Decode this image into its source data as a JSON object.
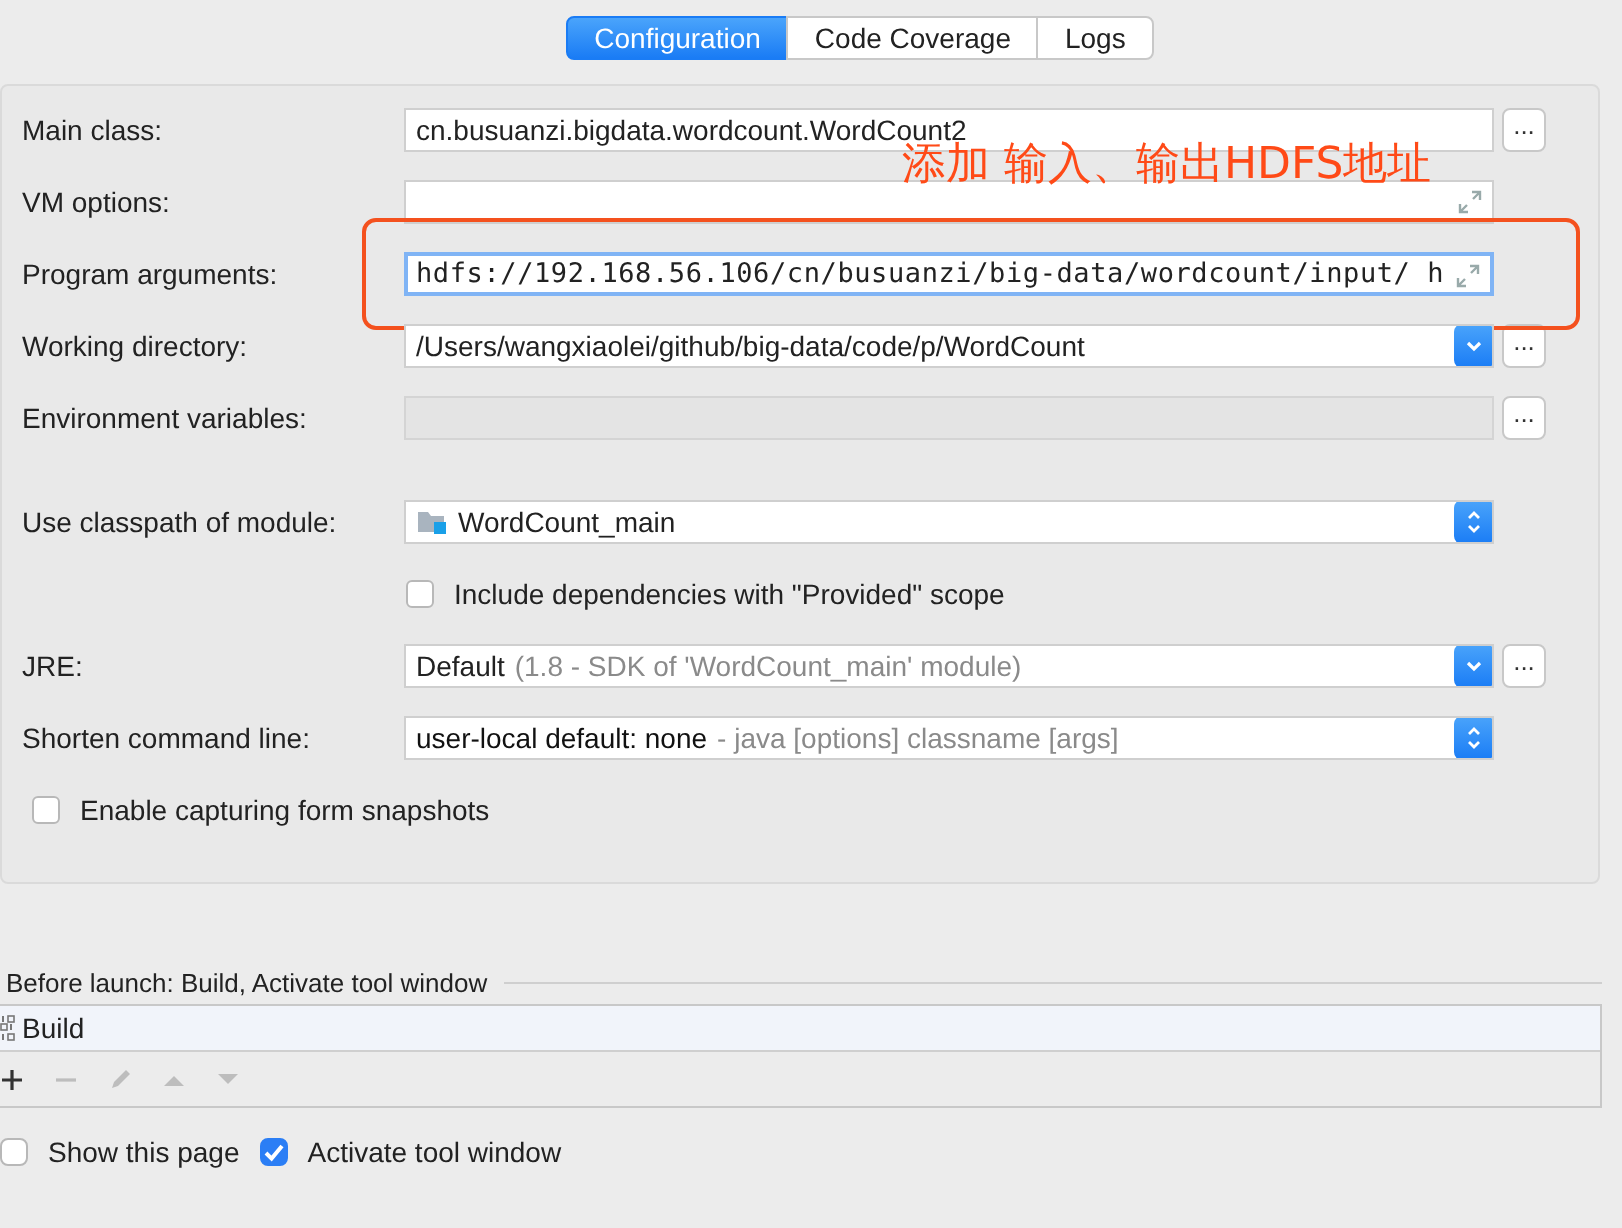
{
  "tabs": [
    {
      "label": "Configuration",
      "selected": true
    },
    {
      "label": "Code Coverage",
      "selected": false
    },
    {
      "label": "Logs",
      "selected": false
    }
  ],
  "form": {
    "annotation": {
      "text": "添加 输入、输出HDFS地址"
    },
    "rows": [
      {
        "kind": "text",
        "label": "Main class:",
        "value": "cn.busuanzi.bigdata.wordcount.WordCount2",
        "browse": "..."
      },
      {
        "kind": "expand",
        "label": "VM options:"
      },
      {
        "kind": "expand",
        "label": "Program arguments:",
        "value": "hdfs://192.168.56.106/cn/busuanzi/big-data/wordcount/input/ h",
        "focused": true,
        "annotated": true
      },
      {
        "kind": "combo",
        "label": "Working directory:",
        "value": "/Users/wangxiaolei/github/big-data/code/p/WordCount",
        "browse": "..."
      },
      {
        "kind": "text",
        "label": "Environment variables:",
        "disabled": true,
        "browse": "..."
      },
      {
        "kind": "module",
        "label": "Use classpath of module:",
        "value": "WordCount_main",
        "gap_before": true
      },
      {
        "kind": "field_checkbox",
        "label": "Include dependencies with \"Provided\" scope",
        "checked": false
      },
      {
        "kind": "combo",
        "label": "JRE:",
        "value": "Default",
        "hint": "(1.8 - SDK of 'WordCount_main' module)",
        "browse": "..."
      },
      {
        "kind": "select",
        "label": "Shorten command line:",
        "value": "user-local default: none",
        "hint": "- java [options] classname [args]"
      },
      {
        "kind": "checkbox",
        "label": "Enable capturing form snapshots",
        "checked": false
      }
    ]
  },
  "before_launch": {
    "title": "Before launch: Build, Activate tool window",
    "items": [
      {
        "label": "Build"
      }
    ],
    "tools": [
      {
        "kind": "add",
        "disabled": false
      },
      {
        "kind": "remove",
        "disabled": true
      },
      {
        "kind": "edit",
        "disabled": true
      },
      {
        "kind": "up",
        "disabled": true
      },
      {
        "kind": "down",
        "disabled": true
      }
    ]
  },
  "options": [
    {
      "label": "Show this page",
      "checked": false
    },
    {
      "label": "Activate tool window",
      "checked": true
    }
  ]
}
